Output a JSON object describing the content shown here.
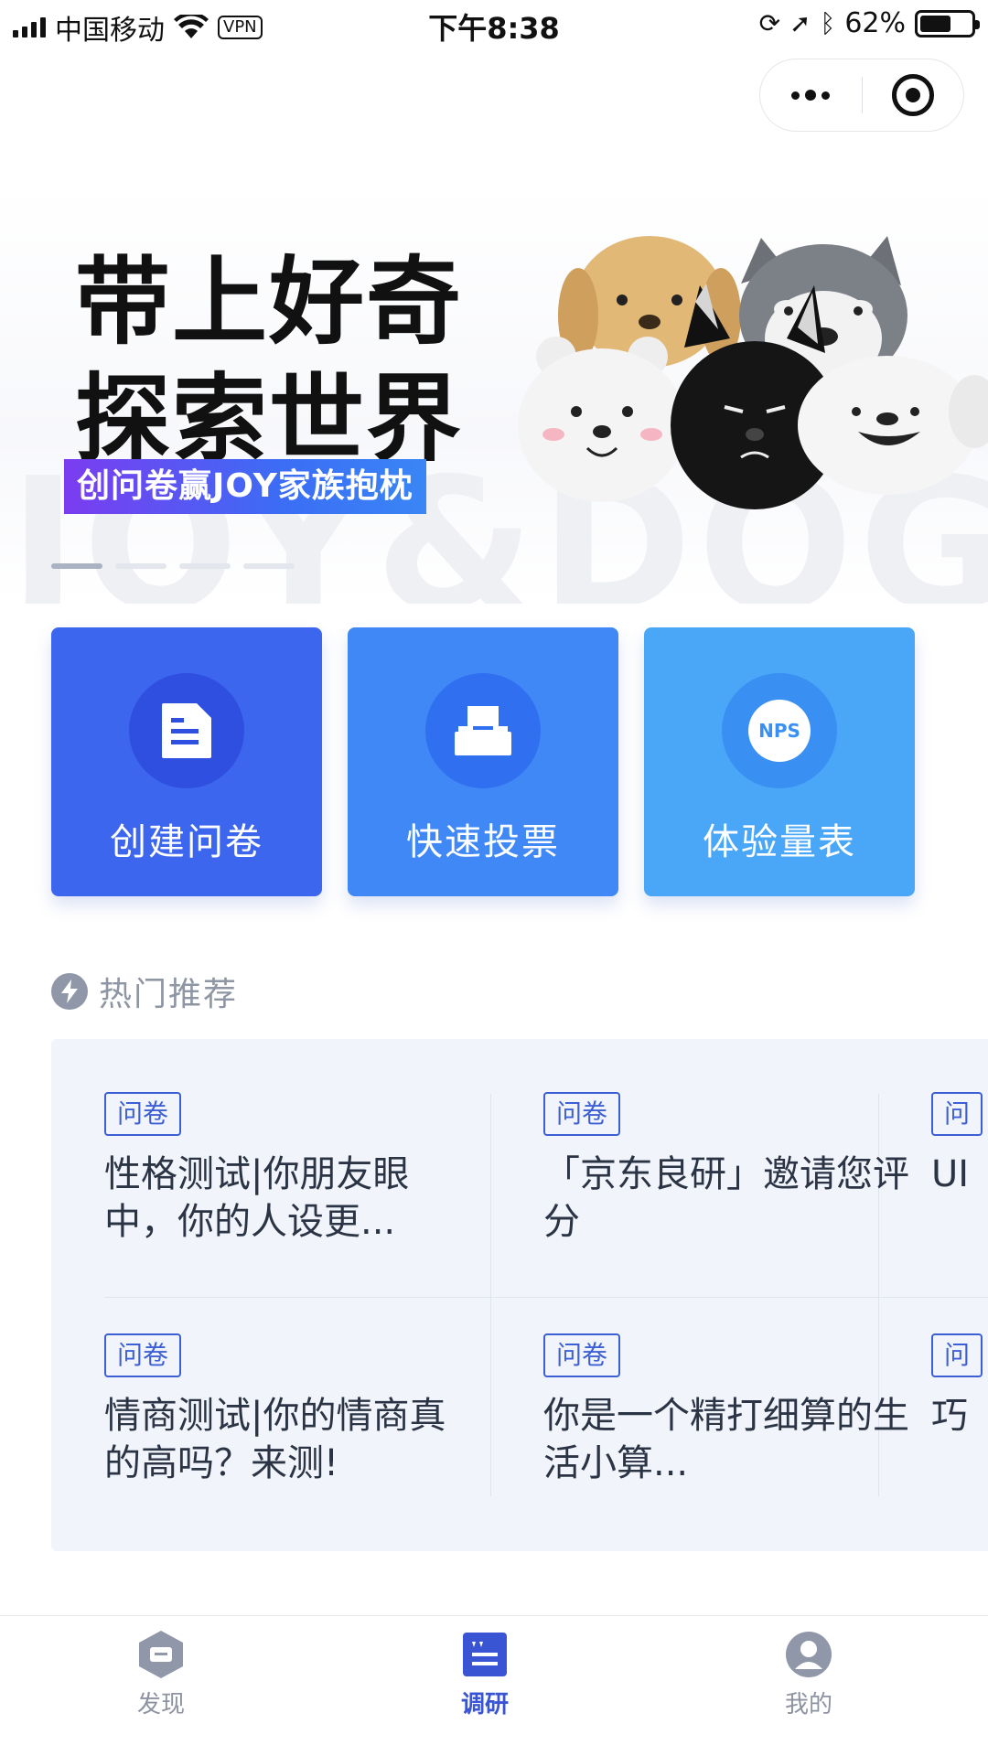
{
  "status_bar": {
    "carrier": "中国移动",
    "vpn": "VPN",
    "time": "下午8:38",
    "battery": "62%",
    "battery_level": 0.62
  },
  "banner": {
    "title_line1": "带上好奇",
    "title_line2": "探索世界",
    "promo": "创问卷赢JOY家族抱枕",
    "watermark": "JOY&DOG",
    "slides": 4,
    "active_slide": 1
  },
  "tools": [
    {
      "label": "创建问卷",
      "icon": "document-icon"
    },
    {
      "label": "快速投票",
      "icon": "ballot-box-icon"
    },
    {
      "label": "体验量表",
      "icon": "nps-icon",
      "badge": "NPS"
    }
  ],
  "hot": {
    "title": "热门推荐",
    "items": [
      {
        "tag": "问卷",
        "title": "性格测试|你朋友眼中，你的人设更..."
      },
      {
        "tag": "问卷",
        "title": "「京东良研」邀请您评分"
      },
      {
        "tag": "问",
        "title": "UI"
      },
      {
        "tag": "问卷",
        "title": "情商测试|你的情商真的高吗？来测!"
      },
      {
        "tag": "问卷",
        "title": "你是一个精打细算的生活小算..."
      },
      {
        "tag": "问",
        "title": "巧"
      }
    ]
  },
  "tabbar": {
    "tabs": [
      {
        "label": "发现",
        "icon": "discover-icon",
        "active": false
      },
      {
        "label": "调研",
        "icon": "survey-icon",
        "active": true
      },
      {
        "label": "我的",
        "icon": "profile-icon",
        "active": false
      }
    ]
  }
}
